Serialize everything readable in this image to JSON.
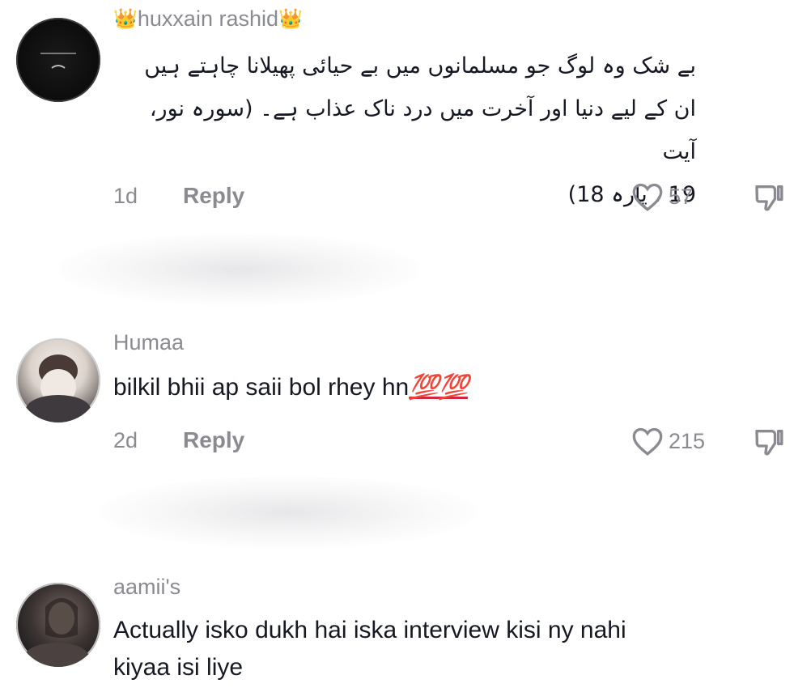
{
  "comments": [
    {
      "username": "huxxain rashid",
      "crown_left": "👑",
      "crown_right": "👑",
      "text_lines": [
        "بے شک وہ لوگ جو مسلمانوں میں بے حیائی پھیلانا چاہتے ہیں",
        "ان کے لیے دنیا اور آخرت میں درد ناک عذاب ہے۔ (سورہ نور، آیت",
        "19 ، پارہ 18)"
      ],
      "time": "1d",
      "reply_label": "Reply",
      "likes": "57"
    },
    {
      "username": "Humaa",
      "text": "bilkil bhii ap saii bol rhey hn",
      "emoji": "💯💯",
      "time": "2d",
      "reply_label": "Reply",
      "likes": "215"
    },
    {
      "username": "aamii's",
      "text_lines": [
        "Actually isko dukh hai iska interview kisi ny nahi",
        "kiyaa isi liye"
      ]
    }
  ],
  "colors": {
    "text": "#161823",
    "secondary": "#8a8b91",
    "emoji_red": "#d1273e"
  },
  "icons": [
    "heart-icon",
    "thumbs-down-icon",
    "crown-icon"
  ]
}
